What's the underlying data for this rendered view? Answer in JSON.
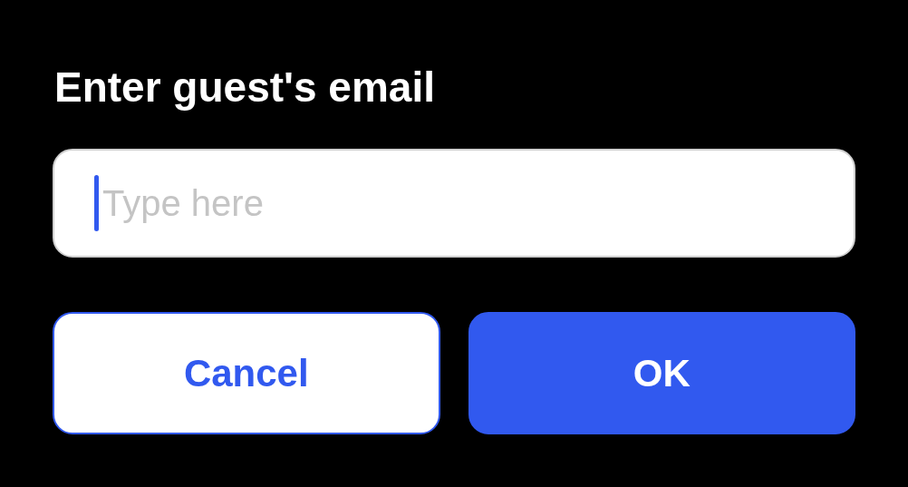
{
  "dialog": {
    "title": "Enter guest's email",
    "field": {
      "placeholder": "Type here",
      "focused": true
    },
    "buttons": [
      {
        "label": "Cancel",
        "kind": "secondary"
      },
      {
        "label": "OK",
        "kind": "primary"
      }
    ]
  }
}
